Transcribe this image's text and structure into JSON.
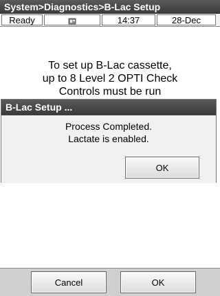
{
  "header": {
    "title": "System>Diagnostics>B-Lac Setup"
  },
  "status_bar": {
    "state": "Ready",
    "icon": "device-icon",
    "time": "14:37",
    "date": "28-Dec"
  },
  "main": {
    "line1": "To set up B-Lac cassette,",
    "line2": "up to 8 Level 2 OPTI Check",
    "line3": "Controls must be run"
  },
  "dialog": {
    "title": "B-Lac Setup ...",
    "line1": "Process Completed.",
    "line2": "Lactate is enabled.",
    "ok_label": "OK"
  },
  "footer": {
    "cancel_label": "Cancel",
    "ok_label": "OK"
  }
}
